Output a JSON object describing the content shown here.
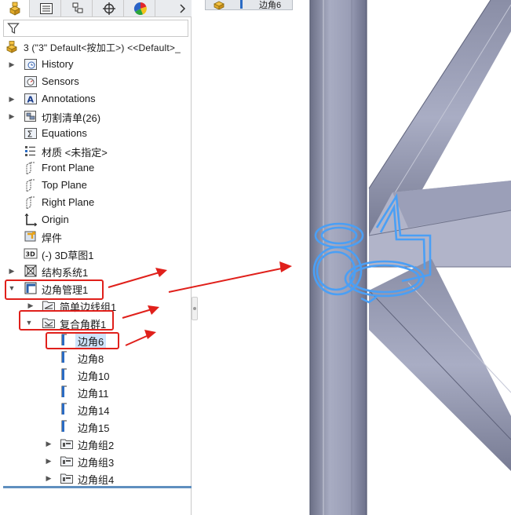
{
  "tree": {
    "root": "3 (\"3\" Default<按加工>) <<Default>_",
    "items": [
      {
        "label": "History"
      },
      {
        "label": "Sensors"
      },
      {
        "label": "Annotations"
      },
      {
        "label": "切割清单(26)"
      },
      {
        "label": "Equations"
      },
      {
        "label": "材质 <未指定>"
      },
      {
        "label": "Front Plane"
      },
      {
        "label": "Top Plane"
      },
      {
        "label": "Right Plane"
      },
      {
        "label": "Origin"
      },
      {
        "label": "焊件"
      },
      {
        "label": "(-) 3D草图1"
      },
      {
        "label": "结构系统1"
      },
      {
        "label": "边角管理1"
      },
      {
        "label": "简单边线组1"
      },
      {
        "label": "复合角群1"
      },
      {
        "label": "边角6"
      },
      {
        "label": "边角8"
      },
      {
        "label": "边角10"
      },
      {
        "label": "边角11"
      },
      {
        "label": "边角14"
      },
      {
        "label": "边角15"
      },
      {
        "label": "边角组2"
      },
      {
        "label": "边角组3"
      },
      {
        "label": "边角组4"
      }
    ]
  },
  "breadcrumb": {
    "label": "边角6"
  },
  "icons": {
    "tabs": [
      "feature-manager-icon",
      "property-manager-icon",
      "configuration-manager-icon",
      "dimxpert-icon",
      "appearance-icon"
    ],
    "more": "chevron-right-icon",
    "filter": "filter-icon"
  },
  "colors": {
    "selection": "#cfe4fb",
    "annotation": "#e0201b",
    "highlight": "#4a9ff5",
    "tube": "#9b9fb8"
  }
}
